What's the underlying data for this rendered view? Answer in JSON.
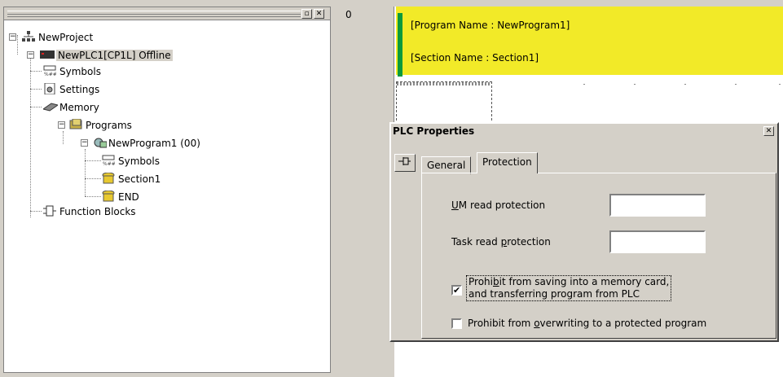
{
  "tree": {
    "items": [
      {
        "label": "NewProject",
        "icon": "project-network-icon"
      },
      {
        "label": "NewPLC1[CP1L] Offline",
        "icon": "plc-device-icon"
      },
      {
        "label": "Symbols",
        "icon": "symbols-icon"
      },
      {
        "label": "Settings",
        "icon": "settings-icon"
      },
      {
        "label": "Memory",
        "icon": "memory-chip-icon"
      },
      {
        "label": "Programs",
        "icon": "programs-icon"
      },
      {
        "label": "NewProgram1 (00)",
        "icon": "program-icon"
      },
      {
        "label": "Symbols",
        "icon": "symbols-icon"
      },
      {
        "label": "Section1",
        "icon": "section-icon"
      },
      {
        "label": "END",
        "icon": "section-icon"
      },
      {
        "label": "Function Blocks",
        "icon": "function-blocks-icon"
      }
    ]
  },
  "ladder": {
    "rung_number": "0",
    "program_name": "[Program Name : NewProgram1]",
    "section_name": "[Section Name : Section1]"
  },
  "dialog": {
    "title": "PLC Properties",
    "tabs": [
      "General",
      "Protection"
    ],
    "active_tab": "Protection",
    "um_read_label_underlined": "U",
    "um_read_label_rest": "M read protection",
    "um_read_value": "",
    "task_read_label_pre": "Task read ",
    "task_read_label_underlined": "p",
    "task_read_label_post": "rotection",
    "task_read_value": "",
    "prohibit_save_line1_pre": "Prohi",
    "prohibit_save_line1_u": "b",
    "prohibit_save_line1_post": "it from saving into a memory card,",
    "prohibit_save_line2": "and transferring program from PLC",
    "prohibit_save_checked": true,
    "prohibit_overwrite_pre": "Prohibit from ",
    "prohibit_overwrite_u": "o",
    "prohibit_overwrite_post": "verwriting to a protected program",
    "prohibit_overwrite_checked": false
  }
}
